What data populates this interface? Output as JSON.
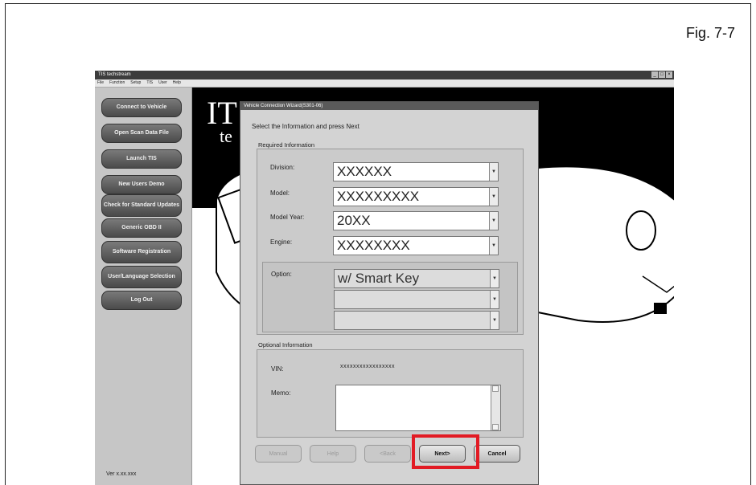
{
  "figure_label": "Fig. 7-7",
  "app": {
    "title": "TIS techstream",
    "menu": [
      "File",
      "Function",
      "Setup",
      "TIS",
      "User",
      "Help"
    ],
    "window_controls": [
      "_",
      "□",
      "×"
    ]
  },
  "sidebar": {
    "buttons": [
      "Connect to Vehicle",
      "Open Scan Data File",
      "Launch TIS",
      "New Users Demo",
      "Check for Standard Updates",
      "Generic OBD II",
      "Software Registration",
      "User/Language Selection",
      "Log Out"
    ],
    "version": "Ver x.xx.xxx"
  },
  "logo": {
    "main": "IT",
    "sub": "te"
  },
  "dialog": {
    "title": "Vehicle Connection Wizard(S301-06)",
    "instruction": "Select the Information and press Next",
    "required_label": "Required Information",
    "fields": [
      {
        "label": "Division:",
        "value": "XXXXXX"
      },
      {
        "label": "Model:",
        "value": "XXXXXXXXX"
      },
      {
        "label": "Model Year:",
        "value": "20XX"
      },
      {
        "label": "Engine:",
        "value": "XXXXXXXX"
      }
    ],
    "option_label": "Option:",
    "option_values": [
      "w/ Smart Key",
      "",
      ""
    ],
    "optional_label": "Optional Information",
    "vin_label": "VIN:",
    "vin_value": "xxxxxxxxxxxxxxxxx",
    "memo_label": "Memo:",
    "buttons": {
      "manual": "Manual",
      "help": "Help",
      "back": "<Back",
      "next": "Next>",
      "cancel": "Cancel"
    }
  },
  "colors": {
    "highlight": "#e21b24",
    "titlebar": "#3d3d3d"
  }
}
